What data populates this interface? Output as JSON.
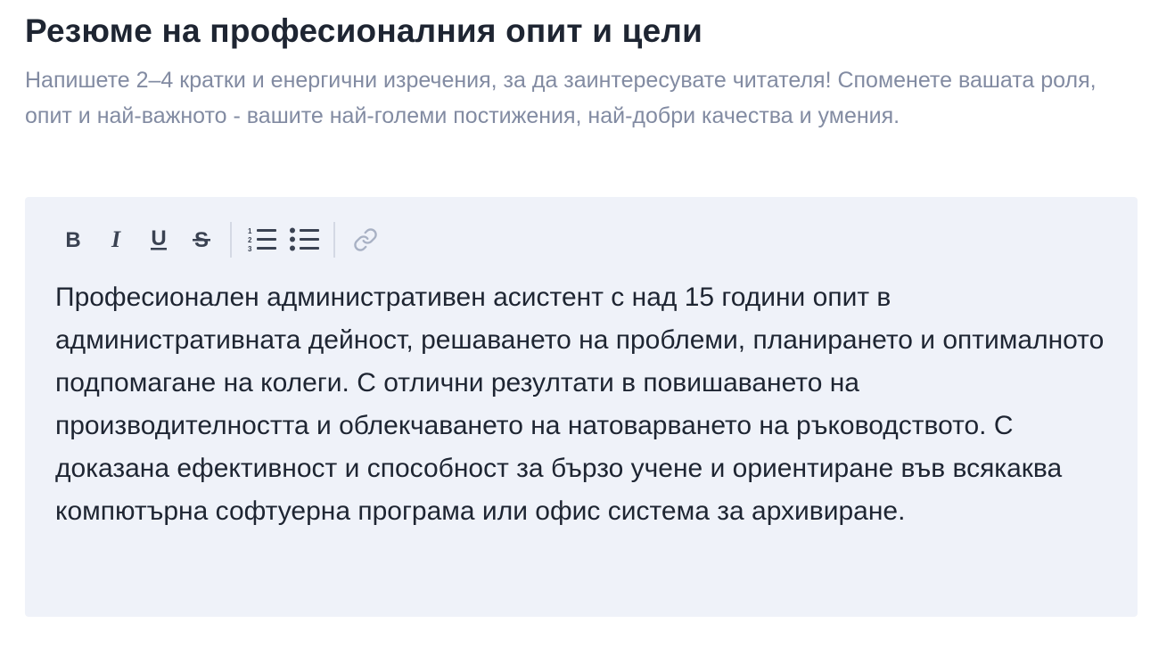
{
  "section": {
    "title": "Резюме на професионалния опит и цели",
    "hint": "Напишете 2–4 кратки и енергични изречения, за да заинтересувате читателя! Споменете вашата роля, опит и най-важното - вашите най-големи постижения, най-добри качества и умения."
  },
  "editor": {
    "toolbar": [
      {
        "name": "bold-icon",
        "group": "format"
      },
      {
        "name": "italic-icon",
        "group": "format"
      },
      {
        "name": "underline-icon",
        "group": "format"
      },
      {
        "name": "strikethrough-icon",
        "group": "format"
      },
      {
        "name": "numbered-list-icon",
        "group": "list"
      },
      {
        "name": "bulleted-list-icon",
        "group": "list"
      },
      {
        "name": "link-icon",
        "group": "link",
        "disabled": true
      }
    ],
    "content": "Професионален административен асистент с над 15 години опит в административната дейност, решаването на проблеми, планирането и оптималното подпомагане на колеги. С отлични резултати в повишаването на производителността и облекчаването на натоварването на ръководството. С доказана ефективност и способност за бързо учене и ориентиране във всякаква компютърна софтуерна програма или офис система за архивиране."
  },
  "colors": {
    "title": "#1e2532",
    "hint": "#828ba2",
    "editor_bg": "#eff2f9",
    "icon": "#3a4252",
    "icon_disabled": "#a8b1c4"
  }
}
